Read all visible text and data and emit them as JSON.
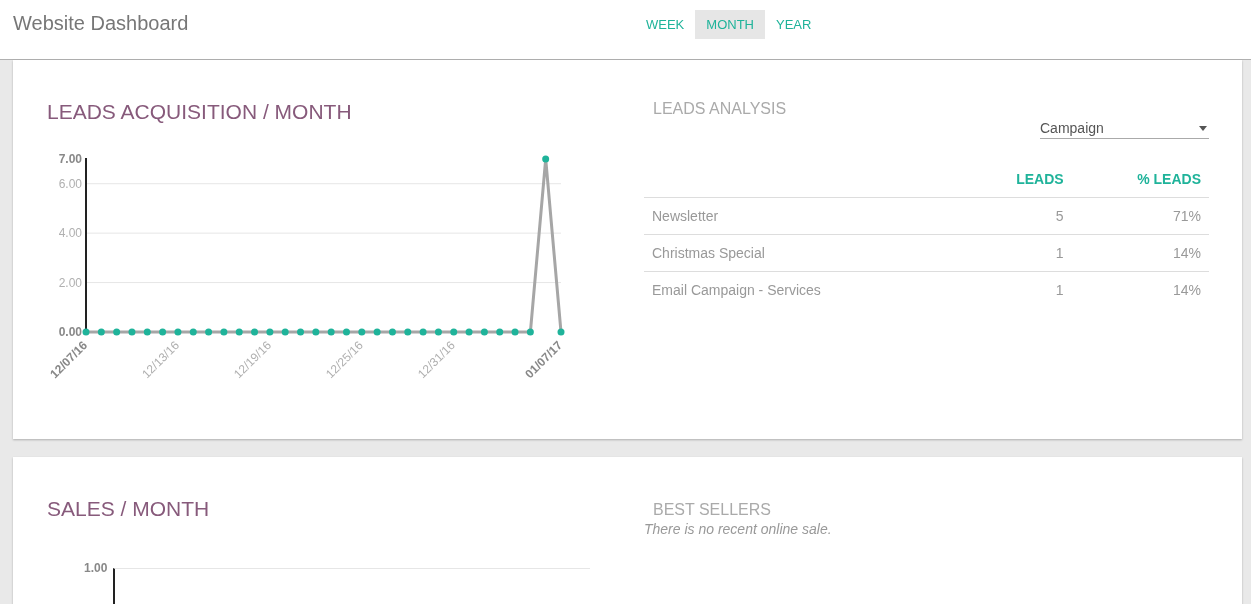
{
  "header": {
    "title": "Website Dashboard",
    "periods": [
      {
        "label": "WEEK",
        "selected": false
      },
      {
        "label": "MONTH",
        "selected": true
      },
      {
        "label": "YEAR",
        "selected": false
      }
    ]
  },
  "leads": {
    "title": "LEADS ACQUISITION / MONTH",
    "chart_data": {
      "type": "line",
      "grid": true,
      "categories": [
        "12/07/16",
        null,
        null,
        null,
        null,
        null,
        "12/13/16",
        null,
        null,
        null,
        null,
        null,
        "12/19/16",
        null,
        null,
        null,
        null,
        null,
        "12/25/16",
        null,
        null,
        null,
        null,
        null,
        "12/31/16",
        null,
        null,
        null,
        null,
        null,
        null,
        "01/07/17"
      ],
      "series": [
        {
          "color": "#a6a6a6",
          "marker": "circle",
          "values": [
            0,
            0,
            0,
            0,
            0,
            0,
            0,
            0,
            0,
            0,
            0,
            0,
            0,
            0,
            0,
            0,
            0,
            0,
            0,
            0,
            0,
            0,
            0,
            0,
            0,
            0,
            0,
            0,
            0,
            0,
            7,
            0
          ]
        }
      ],
      "ylim": [
        0,
        7
      ],
      "yticks": [
        {
          "value": 0,
          "label": "0.00"
        },
        {
          "value": 2,
          "label": "2.00"
        },
        {
          "value": 4,
          "label": "4.00"
        },
        {
          "value": 6,
          "label": "6.00"
        },
        {
          "value": 7,
          "label": "7.00"
        }
      ]
    }
  },
  "analysis": {
    "title": "LEADS ANALYSIS",
    "group_by": "Campaign",
    "columns": [
      "LEADS",
      "% LEADS"
    ],
    "rows": [
      {
        "name": "Newsletter",
        "leads": "5",
        "percent": "71%"
      },
      {
        "name": "Christmas Special",
        "leads": "1",
        "percent": "14%"
      },
      {
        "name": "Email Campaign - Services",
        "leads": "1",
        "percent": "14%"
      }
    ]
  },
  "sales": {
    "title": "SALES / MONTH",
    "y_tick_label": "1.00"
  },
  "best_sellers": {
    "title": "BEST SELLERS",
    "empty_message": "There is no recent online sale."
  }
}
